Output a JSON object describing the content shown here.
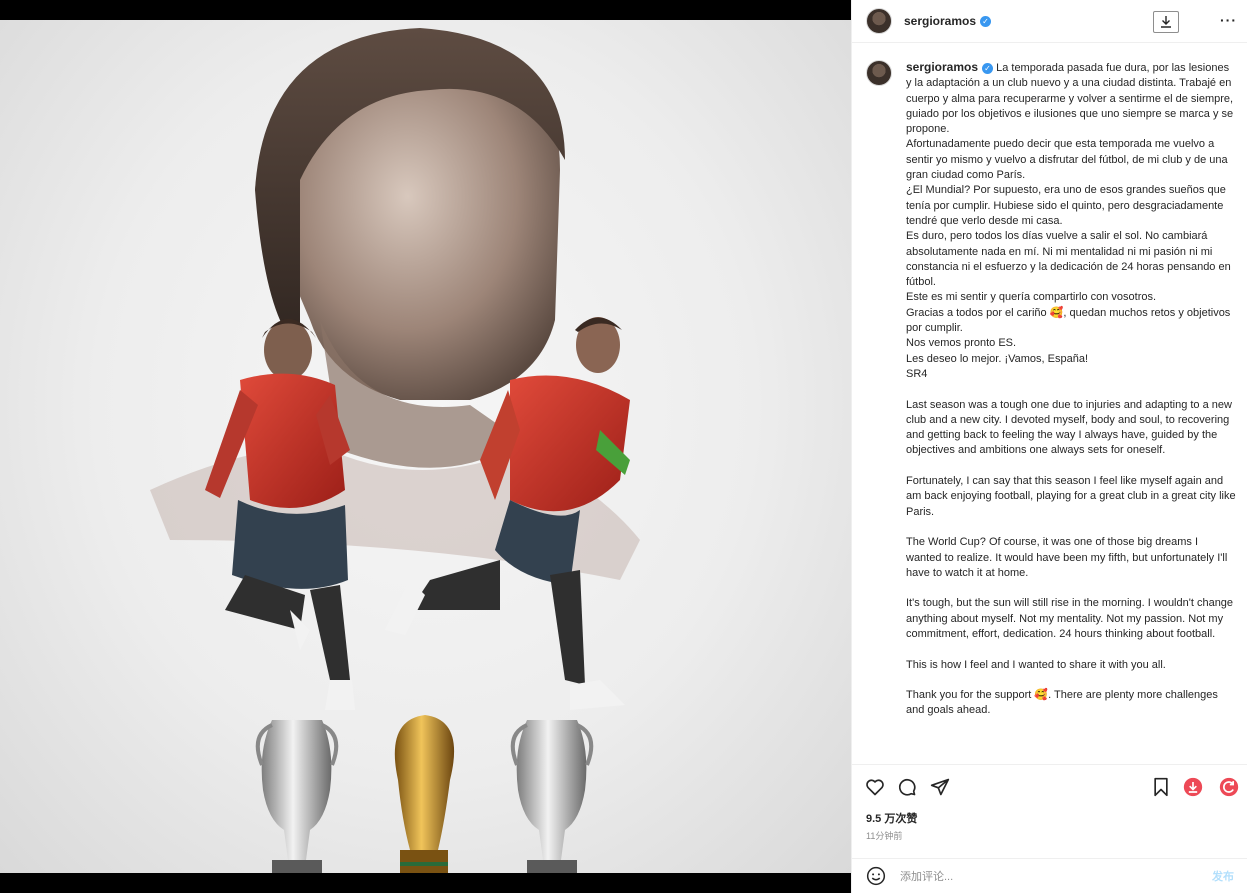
{
  "post": {
    "username": "sergioramos",
    "verified_mark": "✓",
    "caption": "La temporada pasada fue dura, por las lesiones y la adaptación a un club nuevo y a una ciudad distinta. Trabajé en cuerpo y alma para recuperarme y volver a sentirme el de siempre, guiado por los objetivos e ilusiones que uno siempre se marca y se propone.\nAfortunadamente puedo decir que esta temporada me vuelvo a sentir yo mismo y vuelvo a disfrutar del fútbol, de mi club y de una gran ciudad como París.\n¿El Mundial? Por supuesto, era uno de esos grandes sueños que tenía por cumplir. Hubiese sido el quinto, pero desgraciadamente tendré que verlo desde mi casa.\nEs duro, pero todos los días vuelve a salir el sol. No cambiará absolutamente nada en mí. Ni mi mentalidad ni mi pasión ni mi constancia ni el esfuerzo y la dedicación de 24 horas pensando en fútbol.\nEste es mi sentir y quería compartirlo con vosotros.\nGracias a todos por el cariño 🥰, quedan muchos retos y objetivos por cumplir.\nNos vemos pronto ES.\nLes deseo lo mejor. ¡Vamos, España!\nSR4\n\nLast season was a tough one due to injuries and adapting to a new club and a new city. I devoted myself, body and soul, to recovering and getting back to feeling the way I always have, guided by the objectives and ambitions one always sets for oneself.\n\nFortunately, I can say that this season I feel like myself again and am back enjoying football, playing for a great club in a great city like Paris.\n\nThe World Cup? Of course, it was one of those big dreams I wanted to realize. It would have been my fifth, but unfortunately I'll have to watch it at home.\n\nIt's tough, but the sun will still rise in the morning. I wouldn't change anything about myself. Not my mentality. Not my passion. Not my commitment, effort, dedication. 24 hours thinking about football.\n\nThis is how I feel and I wanted to share it with you all.\n\nThank you for the support 🥰. There are plenty more challenges and goals ahead.",
    "likes": "9.5 万次赞",
    "time_ago": "11分钟前"
  },
  "comment": {
    "placeholder": "添加评论...",
    "post_label": "发布"
  },
  "icons": {
    "like": "heart-icon",
    "comment": "comment-icon",
    "share": "share-icon",
    "save": "bookmark-icon",
    "download": "download-icon",
    "refresh": "refresh-icon",
    "more": "more-icon",
    "emoji": "emoji-icon"
  },
  "colors": {
    "verified": "#3897f0",
    "download_accent": "#ed4956",
    "post_button": "#b2dffc"
  }
}
